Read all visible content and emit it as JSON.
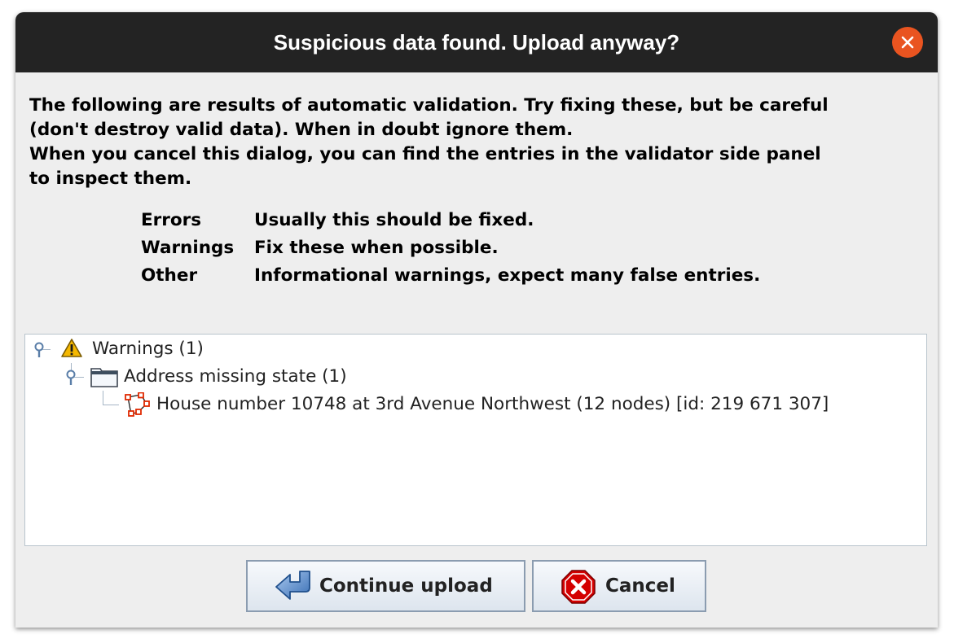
{
  "dialog": {
    "title": "Suspicious data found. Upload anyway?",
    "close_icon": "close-icon",
    "accent_color": "#e95420"
  },
  "message": {
    "line1": "The following are results of automatic validation. Try fixing these, but be careful",
    "line2": "(don't destroy valid data). When in doubt ignore them.",
    "line3": "When you cancel this dialog, you can find the entries in the validator side panel",
    "line4": "to inspect them."
  },
  "legend": [
    {
      "term": "Errors",
      "description": "Usually this should be fixed."
    },
    {
      "term": "Warnings",
      "description": "Fix these when possible."
    },
    {
      "term": "Other",
      "description": "Informational warnings, expect many false entries."
    }
  ],
  "tree": {
    "warnings": {
      "label": "Warnings (1)",
      "icon": "warning-icon"
    },
    "group": {
      "label": "Address missing state (1)",
      "icon": "folder-icon"
    },
    "item": {
      "label": "House number 10748 at 3rd Avenue Northwest (12 nodes) [id: 219 671 307]",
      "icon": "closed-way-icon"
    }
  },
  "buttons": {
    "continue": {
      "label": "Continue upload",
      "icon": "upload-arrow-icon"
    },
    "cancel": {
      "label": "Cancel",
      "icon": "cancel-icon"
    }
  }
}
